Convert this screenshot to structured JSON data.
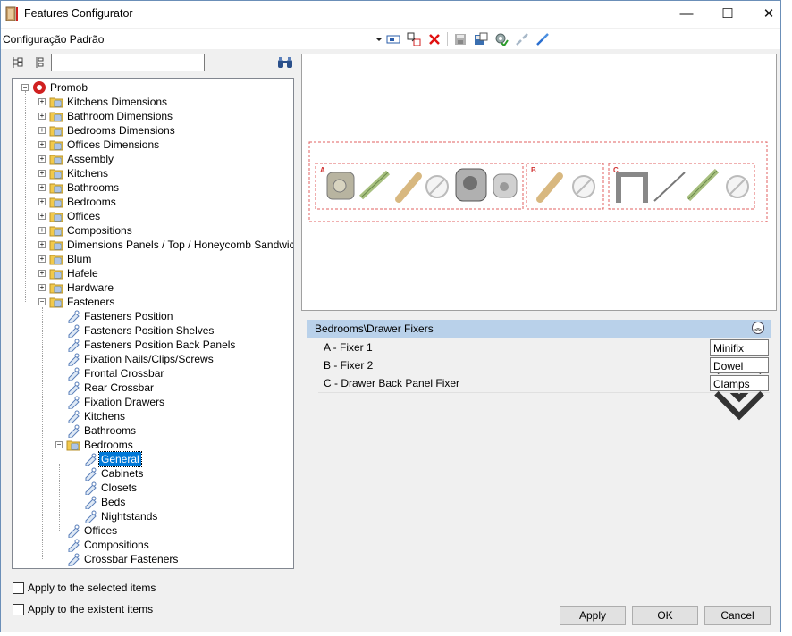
{
  "window": {
    "title": "Features Configurator",
    "minimize": "—",
    "maximize": "☐",
    "close": "✕"
  },
  "toolbar": {
    "configuration_label": "Configuração Padrão",
    "icons": [
      "dropdown-arrow-icon",
      "rename-icon",
      "move-icon",
      "delete-icon",
      "save-icon",
      "save-as-icon",
      "settings-check-icon",
      "disconnect-icon",
      "connect-icon"
    ]
  },
  "left_toolbar": {
    "search_value": "",
    "icons": [
      "expand-tree-icon",
      "collapse-tree-icon",
      "find-icon"
    ]
  },
  "tree": {
    "root": "Promob",
    "level1": [
      "Kitchens Dimensions",
      "Bathroom Dimensions",
      "Bedrooms Dimensions",
      "Offices Dimensions",
      "Assembly",
      "Kitchens",
      "Bathrooms",
      "Bedrooms",
      "Offices",
      "Compositions",
      "Dimensions Panels / Top / Honeycomb Sandwich",
      "Blum",
      "Hafele",
      "Hardware",
      "Fasteners"
    ],
    "fasteners_children": [
      "Fasteners Position",
      "Fasteners Position Shelves",
      "Fasteners Position Back Panels",
      "Fixation Nails/Clips/Screws",
      "Frontal Crossbar",
      "Rear Crossbar",
      "Fixation Drawers",
      "Kitchens",
      "Bathrooms",
      "Bedrooms",
      "Offices",
      "Compositions",
      "Crossbar Fasteners"
    ],
    "bedrooms_children": [
      "General",
      "Cabinets",
      "Closets",
      "Beds",
      "Nightstands"
    ],
    "selected": "General"
  },
  "preview": {
    "zone_labels": [
      "A",
      "B",
      "C"
    ]
  },
  "properties": {
    "header": "Bedrooms\\Drawer Fixers",
    "rows": [
      {
        "name": "A - Fixer 1",
        "value": "Minifix"
      },
      {
        "name": "B - Fixer 2",
        "value": "Dowel"
      },
      {
        "name": "C - Drawer Back Panel Fixer",
        "value": "Clamps"
      }
    ]
  },
  "options": {
    "apply_selected": "Apply to the selected items",
    "apply_existent": "Apply to the existent items"
  },
  "buttons": {
    "apply": "Apply",
    "ok": "OK",
    "cancel": "Cancel"
  }
}
